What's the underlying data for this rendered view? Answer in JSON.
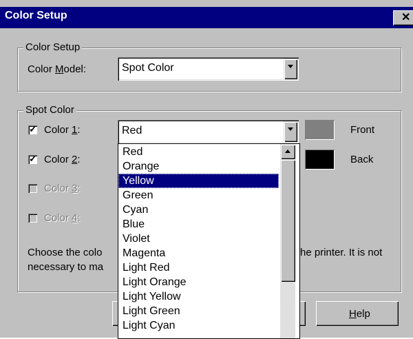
{
  "window": {
    "title": "Color Setup",
    "close_glyph": "✕"
  },
  "color_setup_group": {
    "label": "Color Setup",
    "model_label_pre": "Color ",
    "model_label_accel": "M",
    "model_label_post": "odel:",
    "model_value": "Spot Color"
  },
  "spot_group": {
    "label": "Spot Color",
    "colors": [
      {
        "pre": "Color ",
        "accel": "1",
        "post": ":",
        "checked": true,
        "enabled": true,
        "value": "Red",
        "swatch": "#808080",
        "side_label": "Front"
      },
      {
        "pre": "Color ",
        "accel": "2",
        "post": ":",
        "checked": true,
        "enabled": true,
        "swatch": "#000000",
        "side_label": "Back"
      },
      {
        "pre": "Color ",
        "accel": "3",
        "post": ":",
        "checked": false,
        "enabled": false
      },
      {
        "pre": "Color ",
        "accel": "4",
        "post": ":",
        "checked": false,
        "enabled": false
      }
    ],
    "desc_line1_a": "Choose the colo",
    "desc_line1_b": "he printer.  It is not",
    "desc_line2": "necessary to ma"
  },
  "buttons": {
    "help_accel": "H",
    "help_rest": "elp"
  },
  "dropdown_list": {
    "items": [
      "Red",
      "Orange",
      "Yellow",
      "Green",
      "Cyan",
      "Blue",
      "Violet",
      "Magenta",
      "Light Red",
      "Light Orange",
      "Light Yellow",
      "Light Green",
      "Light Cyan"
    ],
    "selected": "Yellow"
  }
}
